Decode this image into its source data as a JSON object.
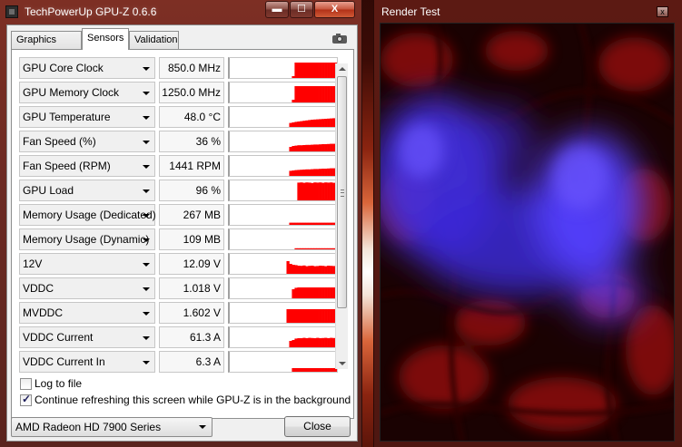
{
  "gpuz": {
    "title": "TechPowerUp GPU-Z 0.6.6",
    "caption_buttons": {
      "minimize": "▬",
      "maximize": "☐",
      "close": "X"
    },
    "tabs": [
      {
        "label": "Graphics Card",
        "active": false
      },
      {
        "label": "Sensors",
        "active": true
      },
      {
        "label": "Validation",
        "active": false
      }
    ],
    "graph_color": "#ff0000",
    "sensors": [
      {
        "label": "GPU Core Clock",
        "value": "850.0 MHz",
        "history": [
          0,
          0,
          0,
          0,
          0,
          0,
          0,
          0,
          0,
          0,
          0,
          0,
          0,
          0,
          0,
          0,
          0,
          0,
          0,
          0,
          0,
          0,
          0,
          0.1,
          0.85,
          0.85,
          0.85,
          0.85,
          0.85,
          0.85,
          0.85,
          0.85,
          0.85,
          0.85,
          0.85,
          0.85,
          0.85,
          0.85,
          0.85,
          0.85
        ]
      },
      {
        "label": "GPU Memory Clock",
        "value": "1250.0 MHz",
        "history": [
          0,
          0,
          0,
          0,
          0,
          0,
          0,
          0,
          0,
          0,
          0,
          0,
          0,
          0,
          0,
          0,
          0,
          0,
          0,
          0,
          0,
          0,
          0,
          0.15,
          0.9,
          0.9,
          0.9,
          0.9,
          0.9,
          0.9,
          0.9,
          0.9,
          0.9,
          0.9,
          0.9,
          0.9,
          0.9,
          0.9,
          0.9,
          0.9
        ]
      },
      {
        "label": "GPU Temperature",
        "value": "48.0 °C",
        "history": [
          0,
          0,
          0,
          0,
          0,
          0,
          0,
          0,
          0,
          0,
          0,
          0,
          0,
          0,
          0,
          0,
          0,
          0,
          0,
          0,
          0,
          0,
          0.22,
          0.25,
          0.28,
          0.3,
          0.32,
          0.34,
          0.36,
          0.38,
          0.4,
          0.41,
          0.42,
          0.43,
          0.44,
          0.45,
          0.46,
          0.47,
          0.48,
          0.48
        ]
      },
      {
        "label": "Fan Speed (%)",
        "value": "36 %",
        "history": [
          0,
          0,
          0,
          0,
          0,
          0,
          0,
          0,
          0,
          0,
          0,
          0,
          0,
          0,
          0,
          0,
          0,
          0,
          0,
          0,
          0,
          0,
          0.25,
          0.3,
          0.32,
          0.34,
          0.34,
          0.35,
          0.36,
          0.36,
          0.37,
          0.38,
          0.38,
          0.39,
          0.4,
          0.4,
          0.41,
          0.42,
          0.42,
          0.43
        ]
      },
      {
        "label": "Fan Speed (RPM)",
        "value": "1441 RPM",
        "history": [
          0,
          0,
          0,
          0,
          0,
          0,
          0,
          0,
          0,
          0,
          0,
          0,
          0,
          0,
          0,
          0,
          0,
          0,
          0,
          0,
          0,
          0,
          0.28,
          0.3,
          0.32,
          0.33,
          0.34,
          0.35,
          0.36,
          0.36,
          0.37,
          0.38,
          0.38,
          0.39,
          0.4,
          0.4,
          0.41,
          0.42,
          0.42,
          0.43
        ]
      },
      {
        "label": "GPU Load",
        "value": "96 %",
        "history": [
          0,
          0,
          0,
          0,
          0,
          0,
          0,
          0,
          0,
          0,
          0,
          0,
          0,
          0,
          0,
          0,
          0,
          0,
          0,
          0,
          0,
          0,
          0,
          0,
          0,
          0.98,
          0.99,
          0.97,
          0.99,
          0.98,
          0.96,
          0.99,
          0.98,
          0.99,
          0.97,
          0.99,
          0.98,
          0.99,
          0.97,
          0.99
        ]
      },
      {
        "label": "Memory Usage (Dedicated)",
        "value": "267 MB",
        "history": [
          0,
          0,
          0,
          0,
          0,
          0,
          0,
          0,
          0,
          0,
          0,
          0,
          0,
          0,
          0,
          0,
          0,
          0,
          0,
          0,
          0,
          0,
          0.12,
          0.12,
          0.12,
          0.12,
          0.12,
          0.12,
          0.12,
          0.12,
          0.12,
          0.12,
          0.12,
          0.12,
          0.12,
          0.12,
          0.12,
          0.12,
          0.12,
          0.12
        ]
      },
      {
        "label": "Memory Usage (Dynamic)",
        "value": "109 MB",
        "history": [
          0,
          0,
          0,
          0,
          0,
          0,
          0,
          0,
          0,
          0,
          0,
          0,
          0,
          0,
          0,
          0,
          0,
          0,
          0,
          0,
          0,
          0,
          0,
          0,
          0.06,
          0.06,
          0.06,
          0.06,
          0.06,
          0.06,
          0.06,
          0.06,
          0.06,
          0.06,
          0.06,
          0.06,
          0.06,
          0.06,
          0.06,
          0.06
        ]
      },
      {
        "label": "12V",
        "value": "12.09 V",
        "history": [
          0,
          0,
          0,
          0,
          0,
          0,
          0,
          0,
          0,
          0,
          0,
          0,
          0,
          0,
          0,
          0,
          0,
          0,
          0,
          0,
          0,
          0.7,
          0.55,
          0.5,
          0.48,
          0.45,
          0.44,
          0.46,
          0.42,
          0.44,
          0.45,
          0.42,
          0.43,
          0.45,
          0.44,
          0.42,
          0.45,
          0.44,
          0.43,
          0.44
        ]
      },
      {
        "label": "VDDC",
        "value": "1.018 V",
        "history": [
          0,
          0,
          0,
          0,
          0,
          0,
          0,
          0,
          0,
          0,
          0,
          0,
          0,
          0,
          0,
          0,
          0,
          0,
          0,
          0,
          0,
          0,
          0,
          0.5,
          0.58,
          0.6,
          0.6,
          0.6,
          0.6,
          0.6,
          0.6,
          0.6,
          0.6,
          0.6,
          0.6,
          0.6,
          0.6,
          0.6,
          0.6,
          0.6
        ]
      },
      {
        "label": "MVDDC",
        "value": "1.602 V",
        "history": [
          0,
          0,
          0,
          0,
          0,
          0,
          0,
          0,
          0,
          0,
          0,
          0,
          0,
          0,
          0,
          0,
          0,
          0,
          0,
          0,
          0,
          0.75,
          0.75,
          0.75,
          0.75,
          0.75,
          0.75,
          0.75,
          0.75,
          0.75,
          0.75,
          0.75,
          0.75,
          0.75,
          0.75,
          0.75,
          0.75,
          0.75,
          0.75,
          0.75
        ]
      },
      {
        "label": "VDDC Current",
        "value": "61.3 A",
        "history": [
          0,
          0,
          0,
          0,
          0,
          0,
          0,
          0,
          0,
          0,
          0,
          0,
          0,
          0,
          0,
          0,
          0,
          0,
          0,
          0,
          0,
          0,
          0.35,
          0.4,
          0.48,
          0.5,
          0.5,
          0.52,
          0.5,
          0.52,
          0.51,
          0.5,
          0.52,
          0.5,
          0.51,
          0.52,
          0.5,
          0.52,
          0.51,
          0.52
        ]
      },
      {
        "label": "VDDC Current In",
        "value": "6.3 A",
        "history": [
          0,
          0,
          0,
          0,
          0,
          0,
          0,
          0,
          0,
          0,
          0,
          0,
          0,
          0,
          0,
          0,
          0,
          0,
          0,
          0,
          0,
          0,
          0,
          0.2,
          0.2,
          0.2,
          0.2,
          0.2,
          0.2,
          0.2,
          0.2,
          0.2,
          0.2,
          0.2,
          0.2,
          0.2,
          0.2,
          0.2,
          0.2,
          0.2
        ]
      }
    ],
    "checkboxes": [
      {
        "label": "Log to file",
        "checked": false
      },
      {
        "label": "Continue refreshing this screen while GPU-Z is in the background",
        "checked": true
      }
    ],
    "gpu_select": {
      "selected": "AMD Radeon HD 7900 Series"
    },
    "close_button": "Close"
  },
  "render_test": {
    "title": "Render Test",
    "close_glyph": "x",
    "colors": {
      "blue": "#4a3cff",
      "red": "#c0180e",
      "dark": "#140101"
    }
  }
}
